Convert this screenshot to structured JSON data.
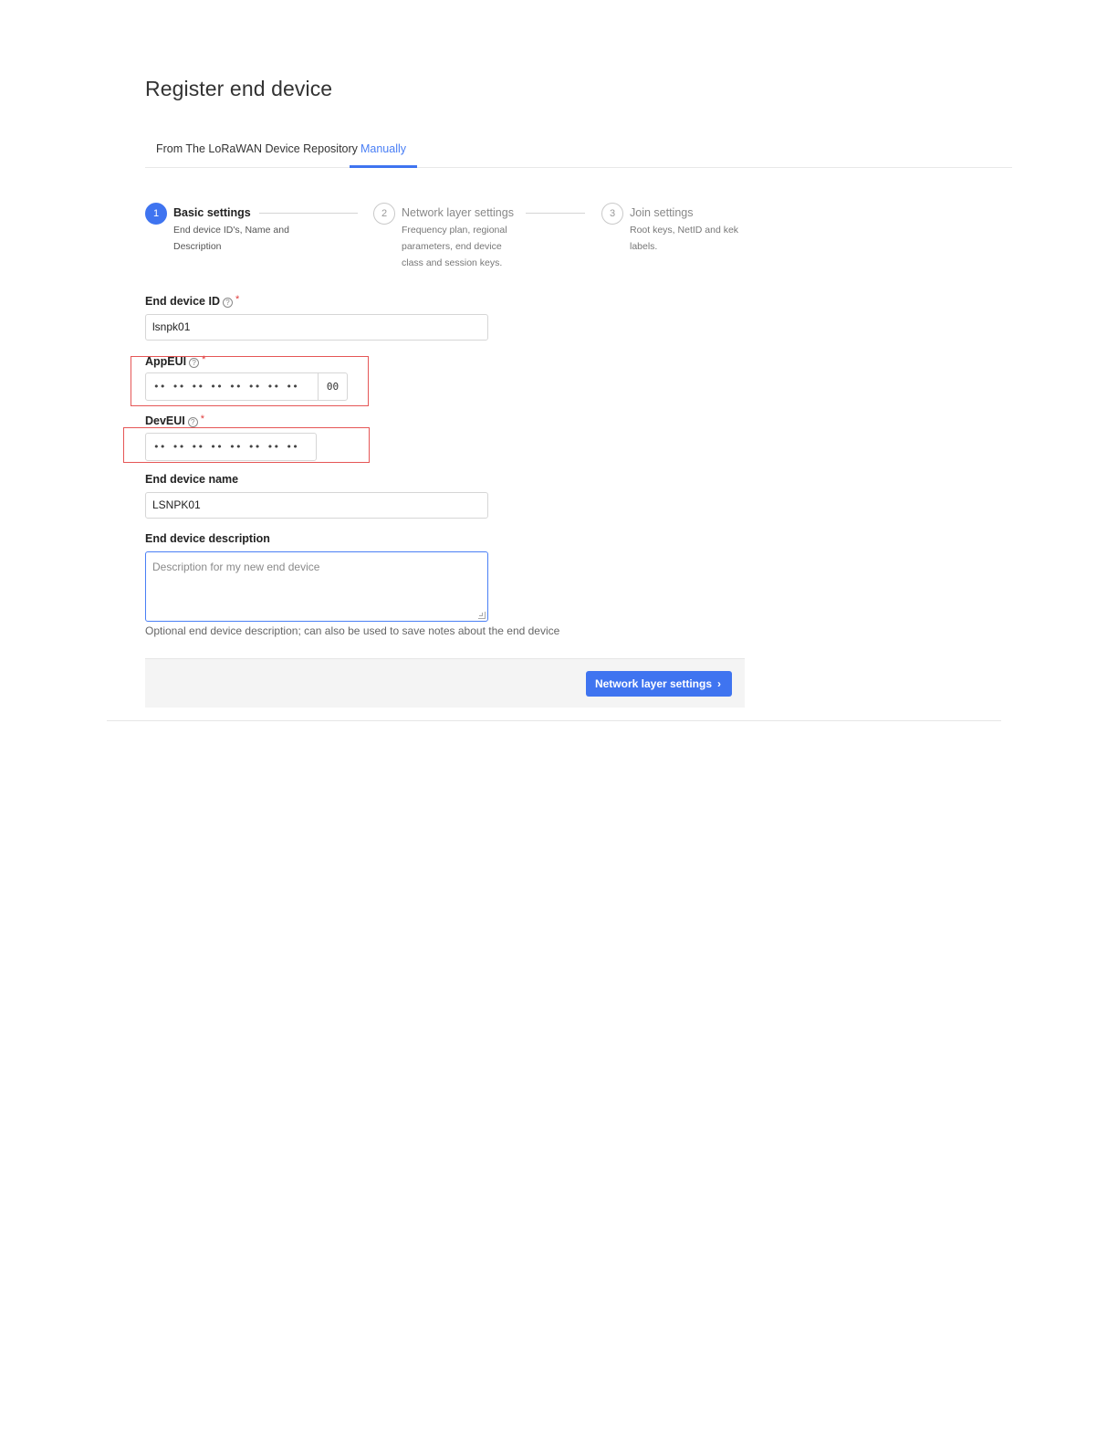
{
  "page": {
    "title": "Register end device"
  },
  "tabs": [
    {
      "label": "From The LoRaWAN Device Repository",
      "active": false
    },
    {
      "label": "Manually",
      "active": true
    }
  ],
  "steps": [
    {
      "number": "1",
      "title": "Basic settings",
      "description": "End device ID's, Name and Description",
      "active": true
    },
    {
      "number": "2",
      "title": "Network layer settings",
      "description": "Frequency plan, regional parameters, end device class and session keys.",
      "active": false
    },
    {
      "number": "3",
      "title": "Join settings",
      "description": "Root keys, NetID and kek labels.",
      "active": false
    }
  ],
  "form": {
    "help_glyph": "?",
    "required_mark": "*",
    "end_device_id": {
      "label": "End device ID",
      "value": "lsnpk01"
    },
    "app_eui": {
      "label": "AppEUI",
      "mask": "•• •• •• •• •• •• •• ••",
      "suffix": "00"
    },
    "dev_eui": {
      "label": "DevEUI",
      "mask": "•• •• •• •• •• •• •• ••"
    },
    "end_device_name": {
      "label": "End device name",
      "value": "LSNPK01"
    },
    "end_device_description": {
      "label": "End device description",
      "placeholder": "Description for my new end device",
      "hint": "Optional end device description; can also be used to save notes about the end device"
    }
  },
  "footer": {
    "next_button": "Network layer settings",
    "next_icon": "chevron-right-icon",
    "next_glyph": "›"
  },
  "colors": {
    "accent": "#3f74f0",
    "highlight": "#e55656",
    "required": "#e03b3b"
  }
}
